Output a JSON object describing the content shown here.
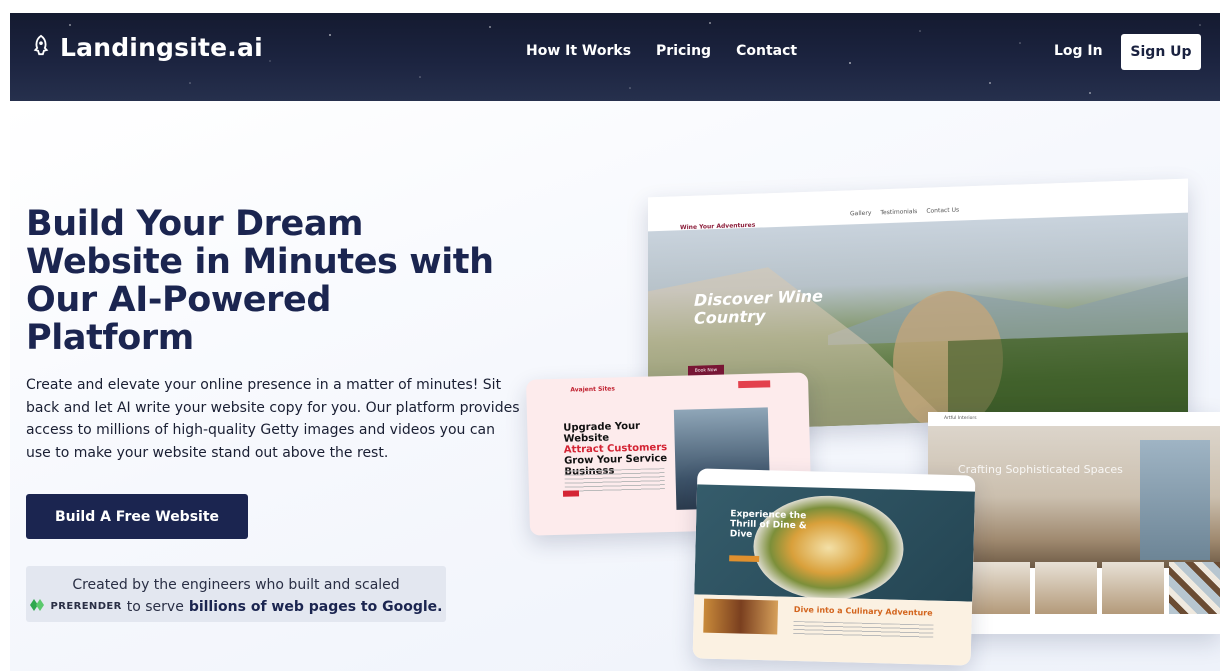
{
  "header": {
    "brand": "Landingsite.ai",
    "nav": [
      "How It Works",
      "Pricing",
      "Contact"
    ],
    "login_label": "Log In",
    "signup_label": "Sign Up"
  },
  "hero": {
    "headline": "Build Your Dream Website in Minutes with Our AI-Powered Platform",
    "description": "Create and elevate your online presence in a matter of minutes! Sit back and let AI write your website copy for you. Our platform provides access to millions of high-quality Getty images and videos you can use to make your website stand out above the rest.",
    "cta_label": "Build A Free Website",
    "credibility": {
      "line1": "Created by the engineers who built and scaled",
      "brand": "PRERENDER",
      "mid": "to serve",
      "bold": "billions of web pages to Google."
    }
  },
  "mockups": {
    "wine": {
      "brand": "Wine Your Adventures",
      "links": [
        "Gallery",
        "Testimonials",
        "Contact Us"
      ],
      "title": "Discover Wine Country",
      "button": "Book Now"
    },
    "agent": {
      "brand": "Avajent Sites",
      "heading_1": "Upgrade Your Website",
      "heading_red": "Attract Customers",
      "heading_2": "Grow Your Service Business"
    },
    "interior": {
      "brand": "Artful Interiors",
      "title": "Crafting Sophisticated Spaces"
    },
    "food": {
      "title": "Experience the Thrill of Dine & Dive",
      "section_title": "Dive into a Culinary Adventure"
    }
  },
  "colors": {
    "navy": "#1b2550",
    "header_bg": "#1c2440",
    "cred_bg": "#e3e7f0"
  },
  "icons": [
    "rocket-icon",
    "prerender-logo-icon"
  ]
}
